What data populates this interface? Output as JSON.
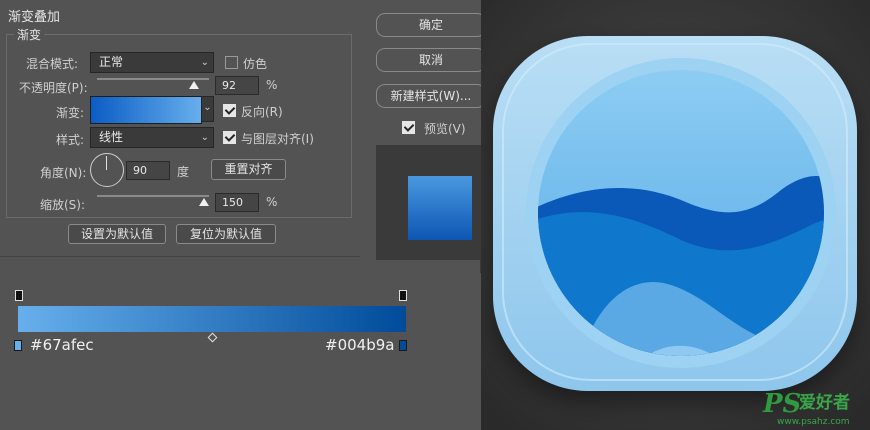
{
  "dialog": {
    "section_title": "渐变叠加",
    "group_title": "渐变",
    "blend_mode": {
      "label": "混合模式:",
      "value": "正常"
    },
    "dither": {
      "label": "仿色",
      "checked": false
    },
    "opacity": {
      "label": "不透明度(P):",
      "value": "92",
      "unit": "%",
      "level": 0.92
    },
    "gradient": {
      "label": "渐变:",
      "from": "#0b5cc6",
      "to": "#67afec"
    },
    "reverse": {
      "label": "反向(R)",
      "checked": true
    },
    "style": {
      "label": "样式:",
      "value": "线性"
    },
    "align_layer": {
      "label": "与图层对齐(I)",
      "checked": true
    },
    "angle": {
      "label": "角度(N):",
      "value": "90",
      "unit": "度"
    },
    "reset_align_button": "重置对齐",
    "scale": {
      "label": "缩放(S):",
      "value": "150",
      "unit": "%",
      "level": 1.0
    },
    "set_default_button": "设置为默认值",
    "reset_default_button": "复位为默认值"
  },
  "side": {
    "ok": "确定",
    "cancel": "取消",
    "new_style": "新建样式(W)...",
    "preview": {
      "label": "预览(V)",
      "checked": true
    }
  },
  "gradient_editor": {
    "left_color": "#67afec",
    "right_color": "#004b9a",
    "left_label": "#67afec",
    "right_label": "#004b9a"
  },
  "icon_colors": {
    "frame_light": "#b9def5",
    "frame_dark": "#8ec6ec",
    "inner_light": "#9dd2f3",
    "circle_top": "#7cc2ee",
    "wave_dark": "#0a58b8",
    "wave_mid": "#0f78cc",
    "wave_light": "#5ba9e4"
  },
  "watermark": {
    "ps": "PS",
    "text": "爱好者",
    "url": "www.psahz.com"
  }
}
